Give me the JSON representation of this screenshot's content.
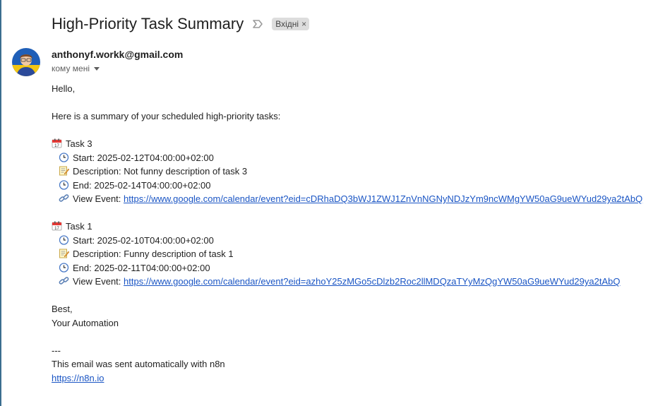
{
  "subject": "High-Priority Task Summary",
  "label": {
    "text": "Вхідні",
    "close": "×"
  },
  "sender": "anthonyf.workk@gmail.com",
  "recipient": "кому мені",
  "body": {
    "greeting": "Hello,",
    "intro": "Here is a summary of your scheduled high-priority tasks:",
    "tasks": [
      {
        "title": "Task 3",
        "start": "Start: 2025-02-12T04:00:00+02:00",
        "description": "Description: Not funny description of task 3",
        "end": "End: 2025-02-14T04:00:00+02:00",
        "view_label": "View Event:",
        "url": "https://www.google.com/calendar/event?eid=cDRhaDQ3bWJ1ZWJ1ZnVnNGNyNDJzYm9ncWMgYW50aG9ueWYud29ya2tAbQ"
      },
      {
        "title": "Task 1",
        "start": "Start: 2025-02-10T04:00:00+02:00",
        "description": "Description: Funny description of task 1",
        "end": "End: 2025-02-11T04:00:00+02:00",
        "view_label": "View Event:",
        "url": "https://www.google.com/calendar/event?eid=azhoY25zMGo5cDlzb2Roc2llMDQzaTYyMzQgYW50aG9ueWYud29ya2tAbQ"
      }
    ],
    "closing": "Best,",
    "signature": "Your Automation",
    "separator": "---",
    "footer": "This email was sent automatically with n8n",
    "footer_link": "https://n8n.io"
  },
  "icons": {
    "importance": "importance-marker-icon",
    "calendar": "calendar-icon",
    "clock": "clock-icon",
    "memo": "memo-icon",
    "link": "link-icon"
  },
  "colors": {
    "link": "#1a55c4",
    "chip_bg": "#dddddd",
    "avatar_bg": "#1f5fb8",
    "avatar_flag_yellow": "#f3c613"
  }
}
